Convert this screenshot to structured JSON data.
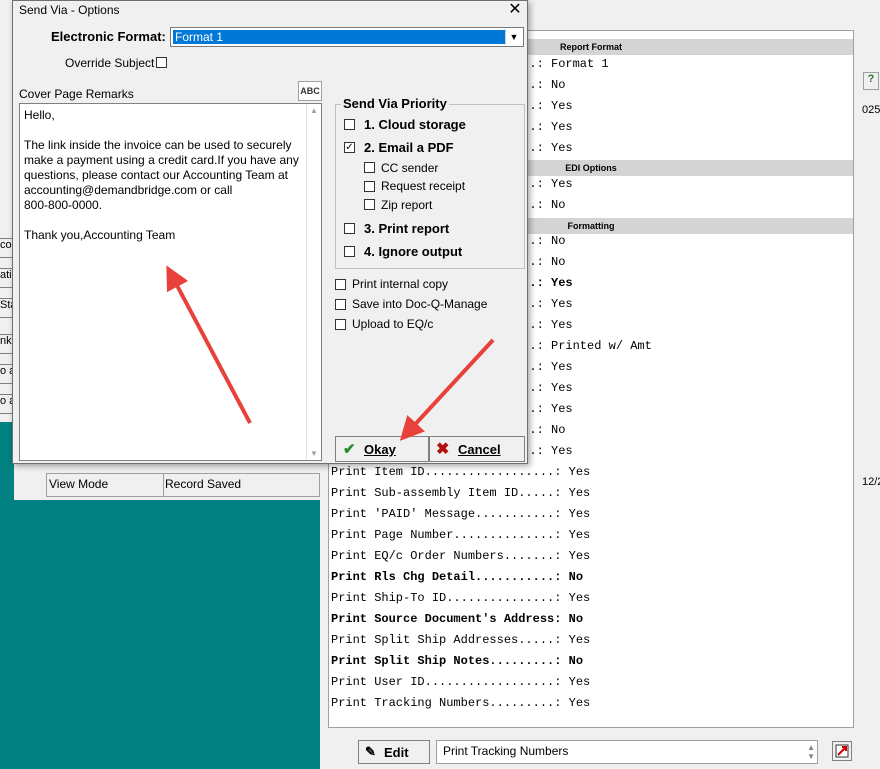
{
  "dialog": {
    "title": "Send Via - Options",
    "close": "✕",
    "electronic_format_label": "Electronic Format:",
    "electronic_format_value": "Format 1",
    "override_subject_label": "Override Subject",
    "cover_remarks_label": "Cover Page Remarks",
    "spell_label": "ABC",
    "remarks_lines": [
      "Hello,",
      "",
      "The link inside the invoice can be used to securely",
      "make a payment using a credit card.If you have any",
      "questions, please contact our Accounting Team at",
      "accounting@demandbridge.com or call",
      "800-800-0000.",
      "",
      "Thank you,Accounting Team"
    ],
    "priority_group_label": "Send Via Priority",
    "priority_options": [
      {
        "label": "1. Cloud storage",
        "checked": false
      },
      {
        "label": "2. Email a PDF",
        "checked": true
      },
      {
        "label": "3. Print report",
        "checked": false
      },
      {
        "label": "4. Ignore output",
        "checked": false
      }
    ],
    "email_suboptions": [
      {
        "label": "CC sender",
        "checked": false
      },
      {
        "label": "Request receipt",
        "checked": false
      },
      {
        "label": "Zip report",
        "checked": false
      }
    ],
    "extra_options": [
      {
        "label": "Print internal copy",
        "checked": false
      },
      {
        "label": "Save into Doc-Q-Manage",
        "checked": false
      },
      {
        "label": "Upload to EQ/c",
        "checked": false
      }
    ],
    "ok_label": "Okay",
    "cancel_label": "Cancel"
  },
  "background": {
    "left_buttons": [
      "co",
      "ati",
      "Sta",
      "nk",
      "o a",
      "o a"
    ],
    "status_bar": {
      "mode": "View Mode",
      "status": "Record Saved"
    },
    "right_icons": [
      "?",
      "025",
      "12/2"
    ],
    "report": {
      "sections": [
        "Report Format",
        "EDI Options",
        "Formatting"
      ],
      "lines": [
        {
          "text": "...: Format 1",
          "bold": false
        },
        {
          "text": "...: No",
          "bold": false
        },
        {
          "text": "...: Yes",
          "bold": false
        },
        {
          "text": "...: Yes",
          "bold": false
        },
        {
          "text": "...: Yes",
          "bold": false
        },
        {
          "text": "...: Yes",
          "bold": false
        },
        {
          "text": "...: No",
          "bold": false
        },
        {
          "text": "...: No",
          "bold": false
        },
        {
          "text": "...: No",
          "bold": false
        },
        {
          "text": "b..: Yes",
          "bold": true
        },
        {
          "text": "...: Yes",
          "bold": false
        },
        {
          "text": "...: Yes",
          "bold": false
        },
        {
          "text": "...: Printed w/ Amt",
          "bold": false
        },
        {
          "text": "...: Yes",
          "bold": false
        },
        {
          "text": "...: Yes",
          "bold": false
        },
        {
          "text": "...: Yes",
          "bold": false
        },
        {
          "text": "...: No",
          "bold": false
        },
        {
          "text": "...: Yes",
          "bold": false
        },
        {
          "text": "Print Item ID..................: Yes",
          "bold": false
        },
        {
          "text": "Print Sub-assembly Item ID.....: Yes",
          "bold": false
        },
        {
          "text": "Print 'PAID' Message...........: Yes",
          "bold": false
        },
        {
          "text": "Print Page Number..............: Yes",
          "bold": false
        },
        {
          "text": "Print EQ/c Order Numbers.......: Yes",
          "bold": false
        },
        {
          "text": "Print Rls Chg Detail...........: No",
          "bold": true
        },
        {
          "text": "Print Ship-To ID...............: Yes",
          "bold": false
        },
        {
          "text": "Print Source Document's Address: No",
          "bold": true
        },
        {
          "text": "Print Split Ship Addresses.....: Yes",
          "bold": false
        },
        {
          "text": "Print Split Ship Notes.........: No",
          "bold": true
        },
        {
          "text": "Print User ID..................: Yes",
          "bold": false
        },
        {
          "text": "Print Tracking Numbers.........: Yes",
          "bold": false
        }
      ]
    },
    "edit_label": "Edit",
    "field_value": "Print Tracking Numbers"
  }
}
